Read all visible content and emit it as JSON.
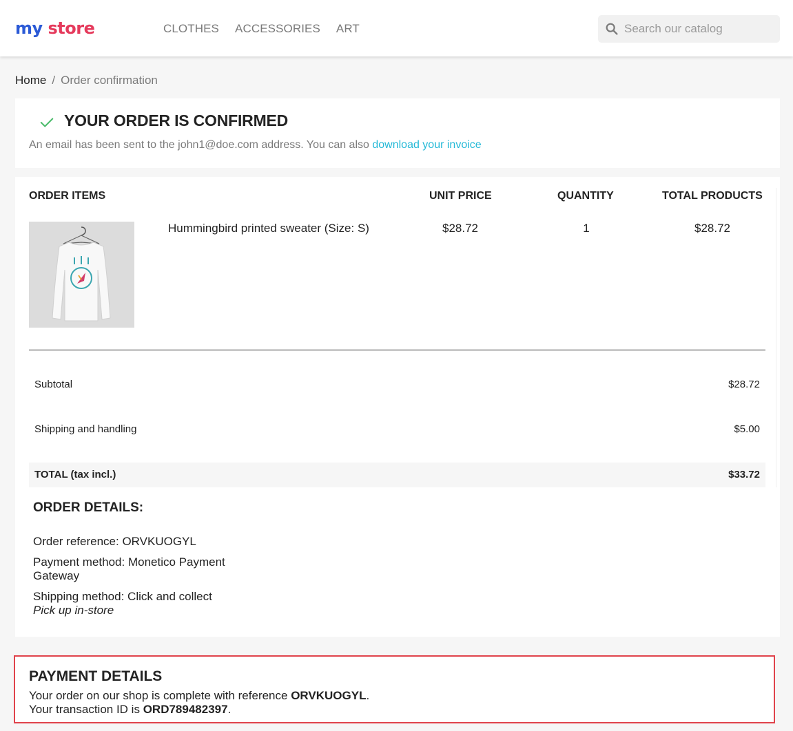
{
  "header": {
    "logo": {
      "part1": "my",
      "part2": "store"
    },
    "nav": [
      "CLOTHES",
      "ACCESSORIES",
      "ART"
    ],
    "search": {
      "placeholder": "Search our catalog",
      "value": ""
    }
  },
  "breadcrumb": {
    "home": "Home",
    "separator": "/",
    "current": "Order confirmation"
  },
  "confirmation": {
    "title": "YOUR ORDER IS CONFIRMED",
    "text_before": "An email has been sent to the john1@doe.com address. You can also ",
    "invoice_link": "download your invoice"
  },
  "order": {
    "headers": {
      "items": "ORDER ITEMS",
      "unit_price": "UNIT PRICE",
      "quantity": "QUANTITY",
      "total_products": "TOTAL PRODUCTS"
    },
    "items": [
      {
        "name": "Hummingbird printed sweater (Size: S)",
        "unit_price": "$28.72",
        "quantity": "1",
        "total": "$28.72"
      }
    ],
    "summary": {
      "subtotal_label": "Subtotal",
      "subtotal_value": "$28.72",
      "shipping_label": "Shipping and handling",
      "shipping_value": "$5.00",
      "total_label": "TOTAL (tax incl.)",
      "total_value": "$33.72"
    }
  },
  "details": {
    "title": "ORDER DETAILS:",
    "reference": "Order reference: ORVKUOGYL",
    "payment": "Payment method: Monetico Payment Gateway",
    "shipping": "Shipping method: Click and collect",
    "shipping_note": "Pick up in-store"
  },
  "payment": {
    "title": "PAYMENT DETAILS",
    "line1_prefix": "Your order on our shop is complete with reference ",
    "line1_ref": "ORVKUOGYL",
    "line1_suffix": ".",
    "line2_prefix": "Your transaction ID is ",
    "line2_id": "ORD789482397",
    "line2_suffix": "."
  },
  "colors": {
    "accent": "#24b9d7",
    "check": "#4cbb6c",
    "alert_border": "#e0434b"
  },
  "icons": {
    "search": "search-icon",
    "check": "check-icon"
  }
}
